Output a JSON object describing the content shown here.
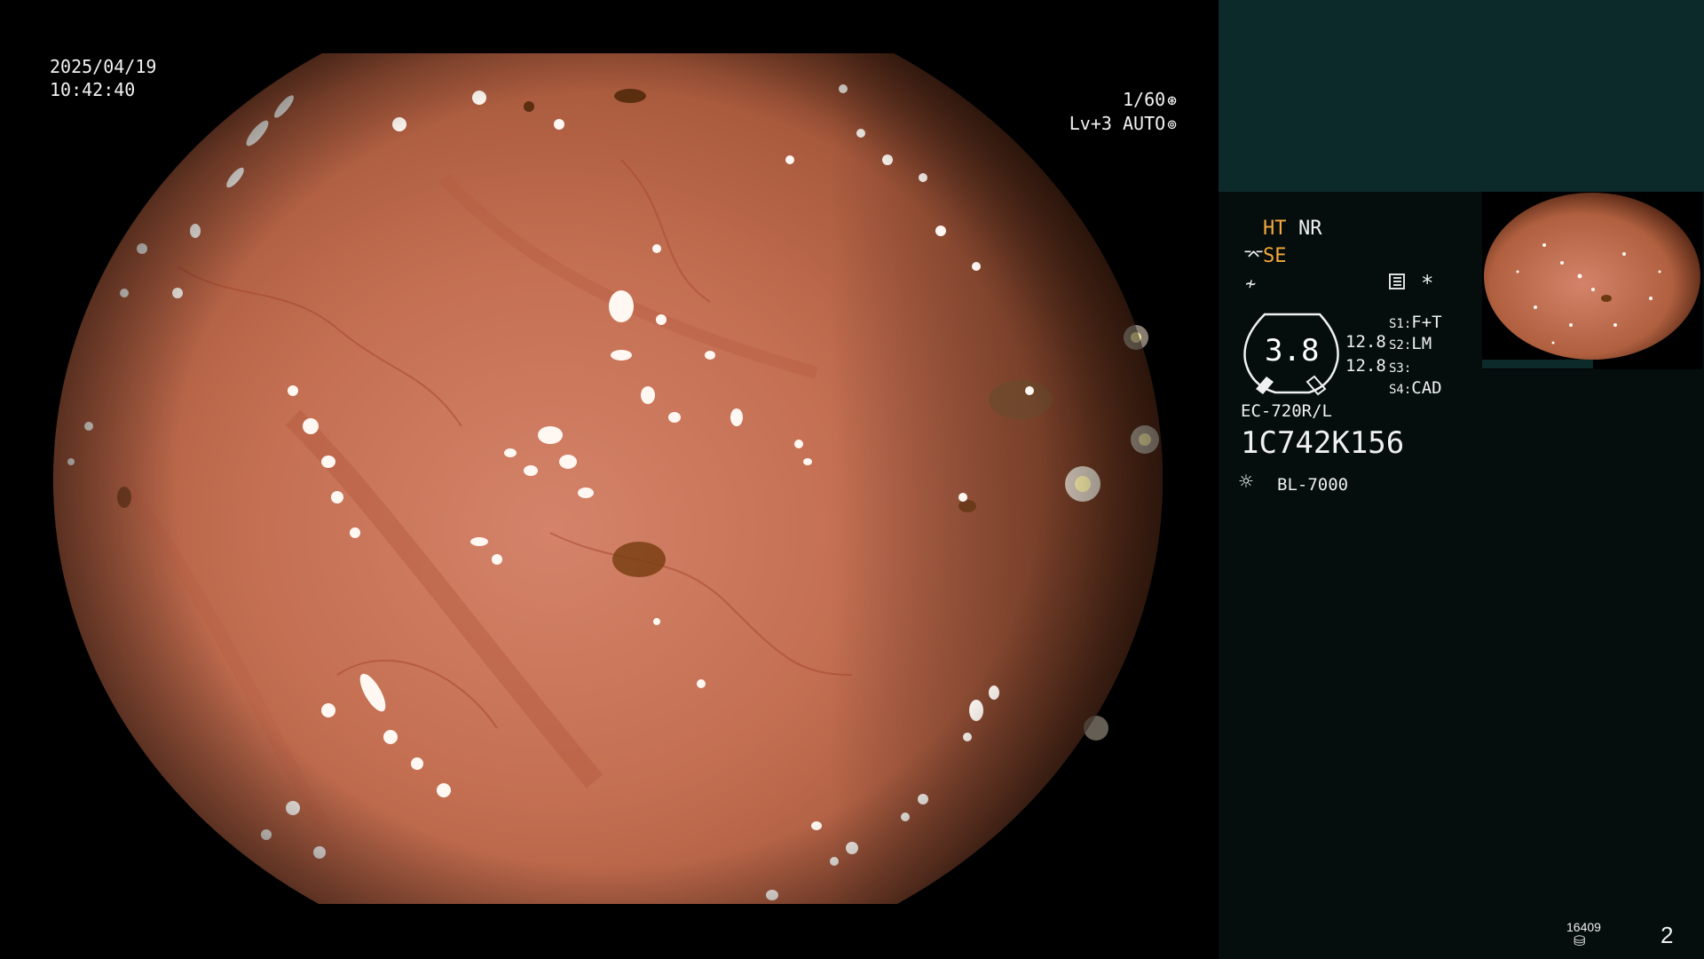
{
  "overlay": {
    "date": "2025/04/19",
    "time": "10:42:40",
    "shutter": "1/60",
    "shutter_icon": "aperture-icon",
    "level": "Lv+3",
    "mode": "AUTO",
    "mode_icon": "auto-iris-icon"
  },
  "status": {
    "ht": "HT",
    "nr": "NR",
    "se": "SE",
    "se_icon": "structure-enhance-icon",
    "pattern_icon": "color-pattern-icon",
    "menu_icon": "settings-menu-icon",
    "asterisk": "*",
    "zoom": "3.8",
    "freq1": "12.8",
    "freq2": "12.8"
  },
  "switches": [
    {
      "key": "S1:",
      "value": "F+T"
    },
    {
      "key": "S2:",
      "value": "LM"
    },
    {
      "key": "S3:",
      "value": ""
    },
    {
      "key": "S4:",
      "value": "CAD"
    }
  ],
  "scope": {
    "model": "EC-720R/L",
    "serial": "1C742K156"
  },
  "light": {
    "icon": "light-source-icon",
    "model": "BL-7000"
  },
  "footer": {
    "counter": "16409",
    "storage_icon": "storage-disk-icon",
    "page": "2"
  },
  "colors": {
    "accent_orange": "#f3a93b",
    "panel_teal": "#0d2a2a",
    "panel_dark": "#050d0d",
    "tissue": "#c7765a"
  }
}
